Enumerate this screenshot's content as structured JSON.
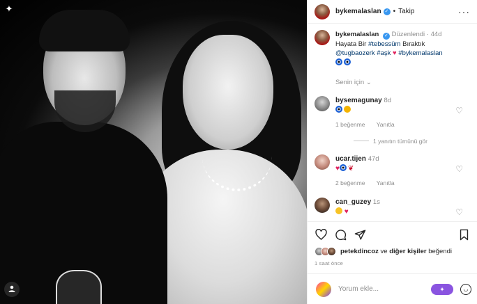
{
  "post": {
    "author": "bykemalaslan",
    "follow_label": "Takip",
    "separator": "•",
    "more_label": "···"
  },
  "caption": {
    "author": "bykemalaslan",
    "edited": "Düzenlendi",
    "age": "44d",
    "text_1": "Hayata Bir ",
    "hashtag_1": "#tebessüm",
    "text_2": " Bıraktık",
    "mention": "@tugbaozerk",
    "hashtag_2": "#aşk",
    "hashtag_3": "#bykemalaslan"
  },
  "for_you_label": "Senin için",
  "comments": [
    {
      "user": "bysemagunay",
      "age": "8d",
      "likes": "1 beğenme",
      "reply": "Yanıtla"
    },
    {
      "user": "ucar.tijen",
      "age": "47d",
      "likes": "2 beğenme",
      "reply": "Yanıtla"
    },
    {
      "user": "can_guzey",
      "age": "1s"
    }
  ],
  "view_replies": "1 yanıtın tümünü gör",
  "liked_by": {
    "user": "petekdincoz",
    "conj": " ve ",
    "others": "diğer kişiler",
    "suffix": " beğendi"
  },
  "timestamp": "1 saat önce",
  "comment_box": {
    "placeholder": "Yorum ekle...",
    "ai_label": "✦"
  },
  "icons": {
    "photo_corner": "sparkle-icon",
    "user_tag": "person-icon",
    "like": "heart-icon",
    "comment": "comment-icon",
    "share": "send-icon",
    "save": "bookmark-icon",
    "emoji": "smiley-icon",
    "verified": "verified-badge-icon"
  },
  "colors": {
    "link": "#00376b",
    "verified": "#3897f0",
    "heart": "#e0245e",
    "ai_button": "#8a54e0",
    "meta": "#8e8e8e"
  }
}
